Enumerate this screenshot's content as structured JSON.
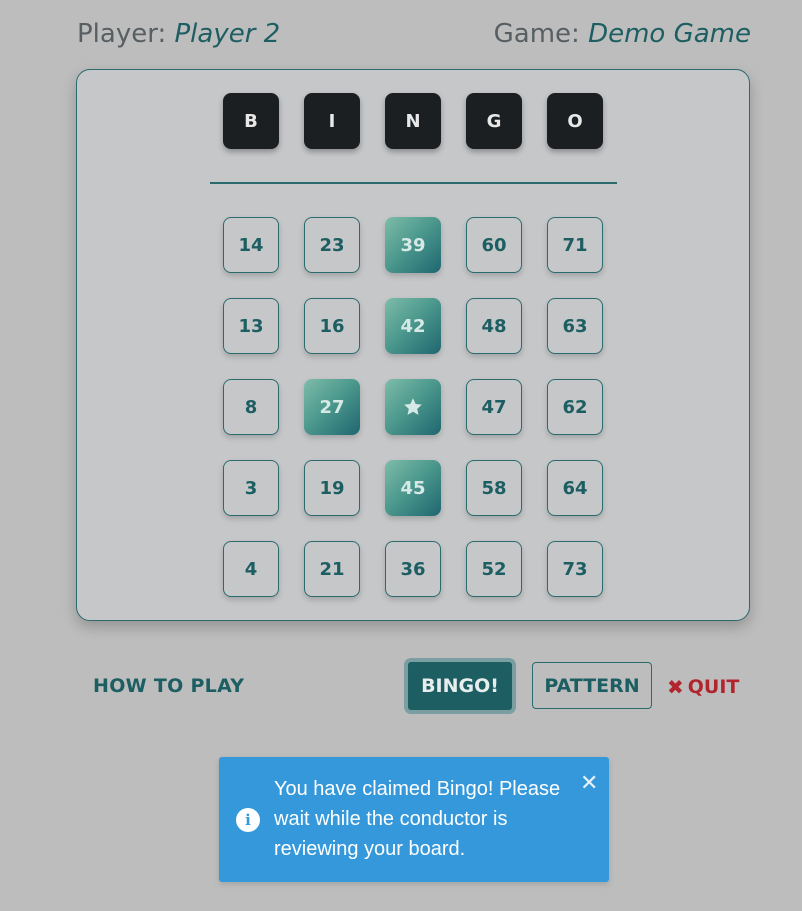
{
  "header": {
    "player_label": "Player:",
    "player_name": "Player 2",
    "game_label": "Game:",
    "game_name": "Demo Game"
  },
  "board": {
    "letters": [
      "B",
      "I",
      "N",
      "G",
      "O"
    ],
    "rows": [
      [
        {
          "value": "14",
          "marked": false
        },
        {
          "value": "23",
          "marked": false
        },
        {
          "value": "39",
          "marked": true
        },
        {
          "value": "60",
          "marked": false
        },
        {
          "value": "71",
          "marked": false
        }
      ],
      [
        {
          "value": "13",
          "marked": false
        },
        {
          "value": "16",
          "marked": false
        },
        {
          "value": "42",
          "marked": true
        },
        {
          "value": "48",
          "marked": false
        },
        {
          "value": "63",
          "marked": false
        }
      ],
      [
        {
          "value": "8",
          "marked": false
        },
        {
          "value": "27",
          "marked": true
        },
        {
          "value": "",
          "marked": true,
          "free": true,
          "icon": "star-icon"
        },
        {
          "value": "47",
          "marked": false
        },
        {
          "value": "62",
          "marked": false
        }
      ],
      [
        {
          "value": "3",
          "marked": false
        },
        {
          "value": "19",
          "marked": false
        },
        {
          "value": "45",
          "marked": true
        },
        {
          "value": "58",
          "marked": false
        },
        {
          "value": "64",
          "marked": false
        }
      ],
      [
        {
          "value": "4",
          "marked": false
        },
        {
          "value": "21",
          "marked": false
        },
        {
          "value": "36",
          "marked": false
        },
        {
          "value": "52",
          "marked": false
        },
        {
          "value": "73",
          "marked": false
        }
      ]
    ]
  },
  "actions": {
    "how_to_play": "HOW TO PLAY",
    "bingo": "BINGO!",
    "pattern": "PATTERN",
    "quit": "QUIT",
    "quit_icon": "close-x-icon"
  },
  "toast": {
    "icon": "info-icon",
    "message": "You have claimed Bingo! Please wait while the conductor is reviewing your board.",
    "close_icon": "close-icon"
  },
  "colors": {
    "background": "#bdbdbd",
    "accent": "#1d5e62",
    "letter_tile": "#1c1f21",
    "quit": "#b1262e",
    "toast": "#3498db"
  }
}
